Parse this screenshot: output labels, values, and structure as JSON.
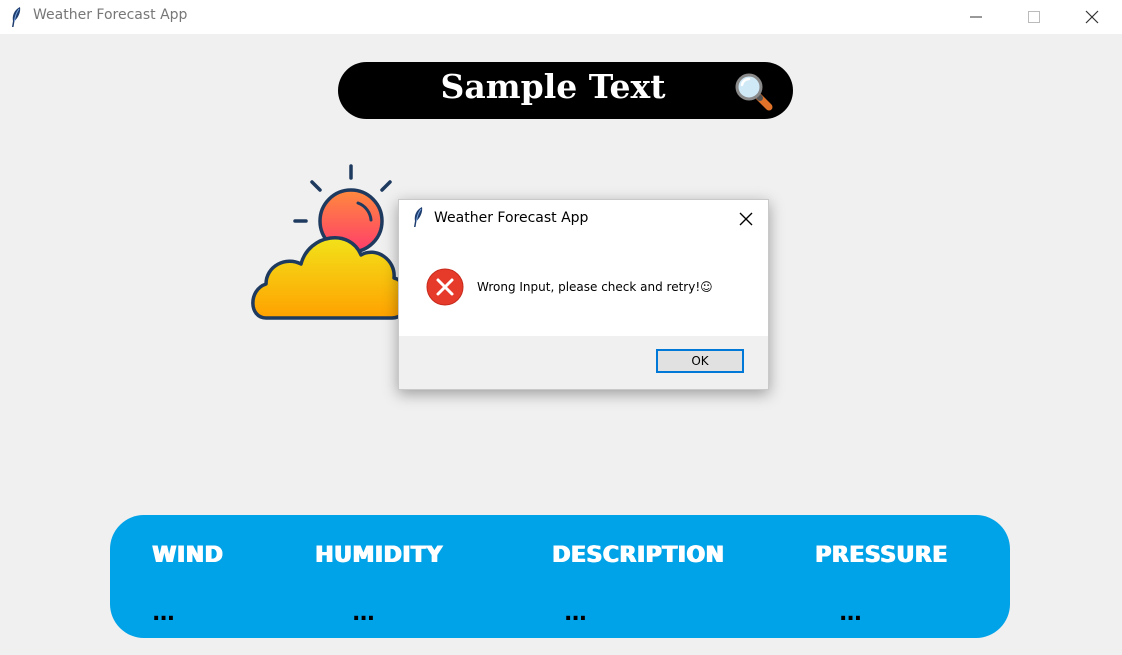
{
  "window": {
    "title": "Weather Forecast App",
    "icons": [
      "feather-icon",
      "minimize-icon",
      "maximize-icon",
      "close-icon"
    ]
  },
  "search": {
    "value": "Sample Text",
    "icon": "search-icon"
  },
  "weather_icon": "partly-cloudy-icon",
  "dialog": {
    "title": "Weather Forecast App",
    "message": "Wrong Input, please check and retry!☺",
    "ok_label": "OK",
    "icon": "error-icon"
  },
  "info": {
    "wind": {
      "label": "WIND",
      "value": "..."
    },
    "humidity": {
      "label": "HUMIDITY",
      "value": "..."
    },
    "description": {
      "label": "DESCRIPTION",
      "value": "..."
    },
    "pressure": {
      "label": "PRESSURE",
      "value": "..."
    }
  },
  "colors": {
    "panel": "#00a2e8",
    "searchbar": "#000000",
    "ok_border": "#0078d7",
    "error_red": "#e81123"
  }
}
